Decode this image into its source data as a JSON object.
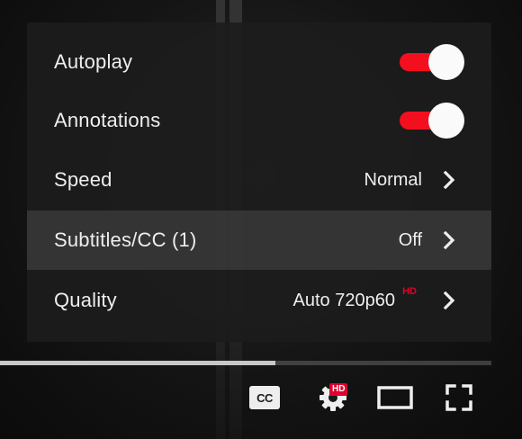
{
  "settings_menu": {
    "items": [
      {
        "label": "Autoplay",
        "toggle_on": true
      },
      {
        "label": "Annotations",
        "toggle_on": true
      },
      {
        "label": "Speed",
        "value": "Normal"
      },
      {
        "label": "Subtitles/CC (1)",
        "value": "Off"
      },
      {
        "label": "Quality",
        "value_prefix": "Auto",
        "value_resolution": "720p60",
        "value_badge": "HD"
      }
    ]
  },
  "progress": {
    "loaded_fraction": 0.56
  },
  "controls": {
    "cc_label": "CC",
    "settings_badge": "HD",
    "icons": [
      "cc-icon",
      "gear-icon",
      "theater-mode-icon",
      "fullscreen-icon"
    ]
  },
  "colors": {
    "toggle_on": "#f40f1f",
    "hd_badge": "#e1002d",
    "menu_bg": "#1c1c1c",
    "text": "#eeeeee"
  }
}
